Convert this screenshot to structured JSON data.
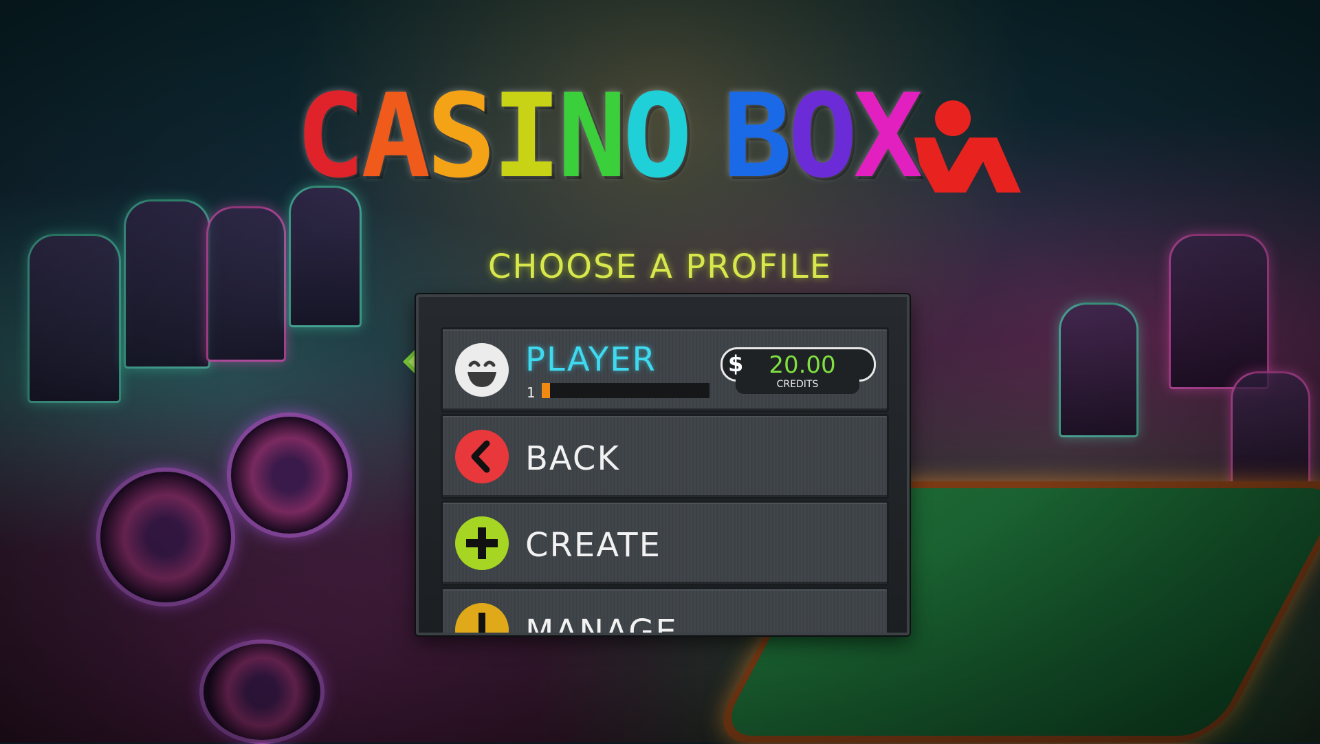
{
  "logo": {
    "letters": [
      {
        "char": "C",
        "color": "#e0232b"
      },
      {
        "char": "A",
        "color": "#f05a1a"
      },
      {
        "char": "S",
        "color": "#f5a316"
      },
      {
        "char": "I",
        "color": "#c9d315"
      },
      {
        "char": "N",
        "color": "#3bcf3b"
      },
      {
        "char": "O",
        "color": "#1fd0d8"
      },
      {
        "char": "B",
        "color": "#1a6ae8"
      },
      {
        "char": "O",
        "color": "#6b2bd6"
      },
      {
        "char": "X",
        "color": "#e21fbf"
      }
    ],
    "figure_color": "#e8231f"
  },
  "subtitle": "CHOOSE A PROFILE",
  "profile": {
    "name": "PLAYER",
    "level": "1",
    "xp_fraction": 0.05,
    "credits_symbol": "$",
    "credits": "20.00",
    "credits_label": "CREDITS",
    "avatar_icon": "smiley-face-icon"
  },
  "menu": {
    "back": {
      "label": "BACK",
      "icon": "chevron-left-icon",
      "color": "#e8383c"
    },
    "create": {
      "label": "CREATE",
      "icon": "plus-icon",
      "color": "#a6d623"
    },
    "manage": {
      "label": "MANAGE",
      "icon": "exclamation-icon",
      "color": "#e0a91a"
    }
  },
  "colors": {
    "accent_yellow": "#d8e84c",
    "player_cyan": "#3fd9f0",
    "selector_green": "#7fd43a"
  }
}
